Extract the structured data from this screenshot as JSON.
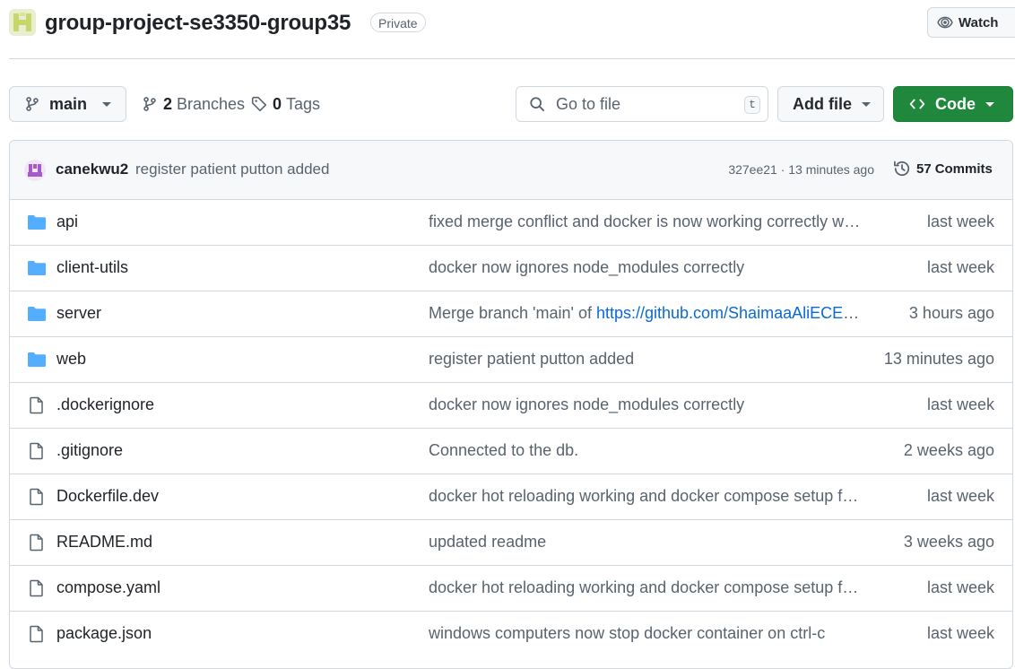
{
  "colors": {
    "accent_green": "#1f883d",
    "folder_blue": "#54aeff",
    "link_blue": "#0969da",
    "muted_text": "#59636e",
    "border": "#d1d9e0"
  },
  "header": {
    "repo_name": "group-project-se3350-group35",
    "visibility": "Private",
    "watch_label": "Watch"
  },
  "toolbar": {
    "branch": "main",
    "branches_count": "2",
    "branches_label": "Branches",
    "tags_count": "0",
    "tags_label": "Tags",
    "search_placeholder": "Go to file",
    "search_shortcut": "t",
    "add_file_label": "Add file",
    "code_label": "Code"
  },
  "commit": {
    "author": "canekwu2",
    "message": "register patient putton added",
    "meta": "327ee21 · 13 minutes ago",
    "count": "57",
    "count_label": "Commits"
  },
  "files": [
    {
      "type": "folder",
      "icon": "folder-icon",
      "name": "api",
      "message": "fixed merge conflict and docker is now working correctly wit…",
      "age": "last week"
    },
    {
      "type": "folder",
      "icon": "folder-icon",
      "name": "client-utils",
      "message": "docker now ignores node_modules correctly",
      "age": "last week"
    },
    {
      "type": "folder",
      "icon": "folder-icon",
      "name": "server",
      "message_prefix": "Merge branch 'main' of ",
      "message_link": "https://github.com/ShaimaaAliECE/g…",
      "age": "3 hours ago"
    },
    {
      "type": "folder",
      "icon": "folder-icon",
      "name": "web",
      "message": "register patient putton added",
      "age": "13 minutes ago"
    },
    {
      "type": "file",
      "icon": "file-icon",
      "name": ".dockerignore",
      "message": "docker now ignores node_modules correctly",
      "age": "last week"
    },
    {
      "type": "file",
      "icon": "file-icon",
      "name": ".gitignore",
      "message": "Connected to the db.",
      "age": "2 weeks ago"
    },
    {
      "type": "file",
      "icon": "file-icon",
      "name": "Dockerfile.dev",
      "message": "docker hot reloading working and docker compose setup fo…",
      "age": "last week"
    },
    {
      "type": "file",
      "icon": "file-icon",
      "name": "README.md",
      "message": "updated readme",
      "age": "3 weeks ago"
    },
    {
      "type": "file",
      "icon": "file-icon",
      "name": "compose.yaml",
      "message": "docker hot reloading working and docker compose setup fo…",
      "age": "last week"
    },
    {
      "type": "file",
      "icon": "file-icon",
      "name": "package.json",
      "message": "windows computers now stop docker container on ctrl-c",
      "age": "last week"
    }
  ]
}
